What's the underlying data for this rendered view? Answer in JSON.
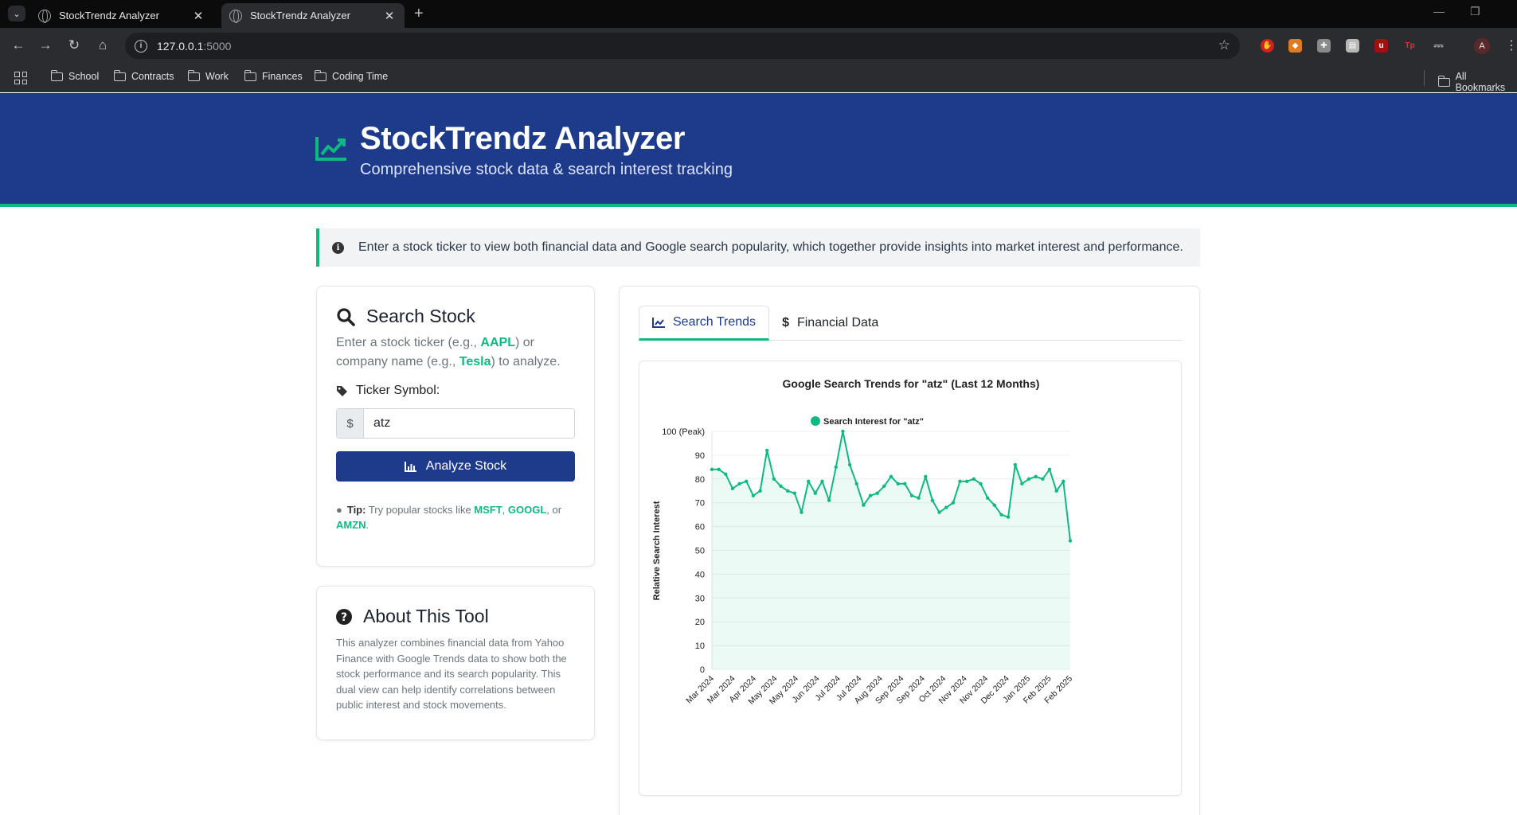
{
  "browser": {
    "tabs": [
      {
        "title": "StockTrendz Analyzer",
        "active": false
      },
      {
        "title": "StockTrendz Analyzer",
        "active": true
      }
    ],
    "url_host": "127.0.0.1",
    "url_port": ":5000",
    "bookmarks": [
      "School",
      "Contracts",
      "Work",
      "Finances",
      "Coding Time"
    ],
    "all_bookmarks": "All Bookmarks",
    "profile_initial": "A"
  },
  "header": {
    "title": "StockTrendz Analyzer",
    "subtitle": "Comprehensive stock data & search interest tracking"
  },
  "alert": {
    "text": "Enter a stock ticker to view both financial data and Google search popularity, which together provide insights into market interest and performance."
  },
  "search_card": {
    "title": "Search Stock",
    "desc_1": "Enter a stock ticker (e.g., ",
    "example_ticker": "AAPL",
    "desc_2": ") or company name (e.g., ",
    "example_company": "Tesla",
    "desc_3": ") to analyze.",
    "ticker_label": "Ticker Symbol:",
    "input_prefix": "$",
    "input_value": "atz",
    "button_label": "Analyze Stock",
    "tip_label": "Tip:",
    "tip_text": " Try popular stocks like ",
    "tip_stocks": [
      "MSFT",
      "GOOGL",
      "AMZN"
    ],
    "tip_sep_1": ", ",
    "tip_sep_2": ", or ",
    "tip_end": "."
  },
  "about_card": {
    "title": "About This Tool",
    "text": "This analyzer combines financial data from Yahoo Finance with Google Trends data to show both the stock performance and its search popularity. This dual view can help identify correlations between public interest and stock movements."
  },
  "main_tabs": [
    {
      "label": "Search Trends",
      "active": true
    },
    {
      "label": "Financial Data",
      "active": false
    }
  ],
  "colors": {
    "primary": "#1e3a8a",
    "accent": "#10b981"
  },
  "chart_data": {
    "type": "line",
    "title": "Google Search Trends for \"atz\" (Last 12 Months)",
    "ylabel": "Relative Search Interest",
    "xlabel": "",
    "legend": "Search Interest for \"atz\"",
    "legend_position": "top",
    "ylim": [
      0,
      100
    ],
    "y_ticks": [
      "0",
      "10",
      "20",
      "30",
      "40",
      "50",
      "60",
      "70",
      "80",
      "90",
      "100 (Peak)"
    ],
    "x_tick_labels": [
      "Mar 2024",
      "Mar 2024",
      "Apr 2024",
      "May 2024",
      "May 2024",
      "Jun 2024",
      "Jul 2024",
      "Jul 2024",
      "Aug 2024",
      "Sep 2024",
      "Sep 2024",
      "Oct 2024",
      "Nov 2024",
      "Nov 2024",
      "Dec 2024",
      "Jan 2025",
      "Feb 2025",
      "Feb 2025"
    ],
    "grid": true,
    "fill": true,
    "series": [
      {
        "name": "Search Interest for \"atz\"",
        "values": [
          84,
          84,
          82,
          76,
          78,
          79,
          73,
          75,
          92,
          80,
          77,
          75,
          74,
          66,
          79,
          74,
          79,
          71,
          85,
          100,
          86,
          78,
          69,
          73,
          74,
          77,
          81,
          78,
          78,
          73,
          72,
          81,
          71,
          66,
          68,
          70,
          79,
          79,
          80,
          78,
          72,
          69,
          65,
          64,
          86,
          78,
          80,
          81,
          80,
          84,
          75,
          79,
          54
        ]
      }
    ]
  }
}
